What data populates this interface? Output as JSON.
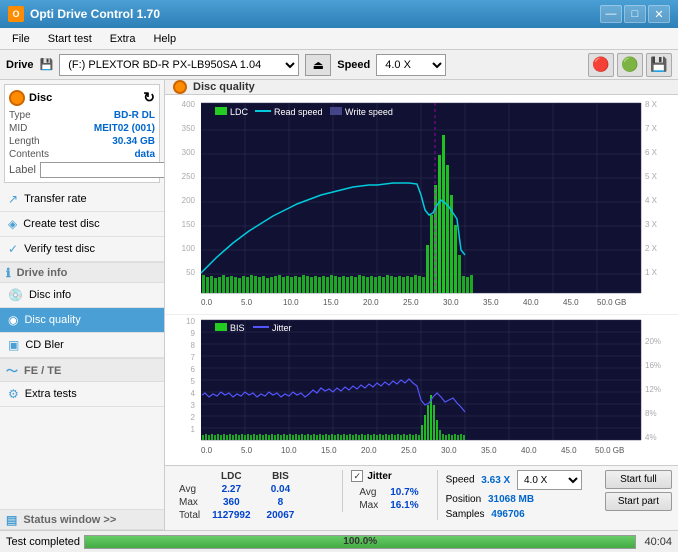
{
  "titlebar": {
    "title": "Opti Drive Control 1.70",
    "minimize": "—",
    "maximize": "□",
    "close": "✕"
  },
  "menubar": {
    "items": [
      "File",
      "Start test",
      "Extra",
      "Help"
    ]
  },
  "drivebar": {
    "label": "Drive",
    "drive_value": "(F:)  PLEXTOR BD-R  PX-LB950SA 1.04",
    "speed_label": "Speed",
    "speed_value": "4.0 X"
  },
  "disc": {
    "header": "Disc",
    "type_label": "Type",
    "type_value": "BD-R DL",
    "mid_label": "MID",
    "mid_value": "MEIT02 (001)",
    "length_label": "Length",
    "length_value": "30.34 GB",
    "contents_label": "Contents",
    "contents_value": "data",
    "label_label": "Label",
    "label_value": ""
  },
  "nav": {
    "items": [
      {
        "id": "transfer-rate",
        "label": "Transfer rate",
        "icon": "↗"
      },
      {
        "id": "create-test-disc",
        "label": "Create test disc",
        "icon": "+"
      },
      {
        "id": "verify-test-disc",
        "label": "Verify test disc",
        "icon": "✓"
      },
      {
        "id": "drive-info",
        "label": "Drive info",
        "icon": "ℹ"
      },
      {
        "id": "disc-info",
        "label": "Disc info",
        "icon": "📀"
      },
      {
        "id": "disc-quality",
        "label": "Disc quality",
        "icon": "◉",
        "active": true
      },
      {
        "id": "cd-bler",
        "label": "CD Bler",
        "icon": "◈"
      },
      {
        "id": "fe-te",
        "label": "FE / TE",
        "icon": "~"
      },
      {
        "id": "extra-tests",
        "label": "Extra tests",
        "icon": "⚙"
      }
    ]
  },
  "disc_quality": {
    "header": "Disc quality",
    "legend": {
      "ldc": "LDC",
      "read_speed": "Read speed",
      "write_speed": "Write speed",
      "bis": "BIS",
      "jitter": "Jitter"
    },
    "top_chart": {
      "y_left_max": 400,
      "y_right_labels": [
        "8 X",
        "7 X",
        "6 X",
        "5 X",
        "4 X",
        "3 X",
        "2 X",
        "1 X"
      ],
      "y_left_labels": [
        "400",
        "350",
        "300",
        "250",
        "200",
        "150",
        "100",
        "50"
      ],
      "x_labels": [
        "0.0",
        "5.0",
        "10.0",
        "15.0",
        "20.0",
        "25.0",
        "30.0",
        "35.0",
        "40.0",
        "45.0",
        "50.0 GB"
      ]
    },
    "bottom_chart": {
      "y_left_labels": [
        "10",
        "9",
        "8",
        "7",
        "6",
        "5",
        "4",
        "3",
        "2",
        "1"
      ],
      "y_right_labels": [
        "20%",
        "16%",
        "12%",
        "8%",
        "4%"
      ],
      "x_labels": [
        "0.0",
        "5.0",
        "10.0",
        "15.0",
        "20.0",
        "25.0",
        "30.0",
        "35.0",
        "40.0",
        "45.0",
        "50.0 GB"
      ]
    },
    "stats": {
      "columns": [
        "LDC",
        "BIS",
        "",
        "Jitter"
      ],
      "rows": [
        {
          "label": "Avg",
          "ldc": "2.27",
          "bis": "0.04",
          "jitter": "10.7%"
        },
        {
          "label": "Max",
          "ldc": "360",
          "bis": "8",
          "jitter": "16.1%"
        },
        {
          "label": "Total",
          "ldc": "1127992",
          "bis": "20067",
          "jitter": ""
        }
      ],
      "speed_label": "Speed",
      "speed_value": "3.63 X",
      "speed_select": "4.0 X",
      "position_label": "Position",
      "position_value": "31068 MB",
      "samples_label": "Samples",
      "samples_value": "496706",
      "start_full": "Start full",
      "start_part": "Start part",
      "jitter_checkbox": true,
      "jitter_label": "Jitter"
    }
  },
  "status_window": {
    "label": "Status window >>"
  },
  "statusbar": {
    "message": "Test completed",
    "progress": 100,
    "progress_text": "100.0%",
    "time": "40:04"
  }
}
